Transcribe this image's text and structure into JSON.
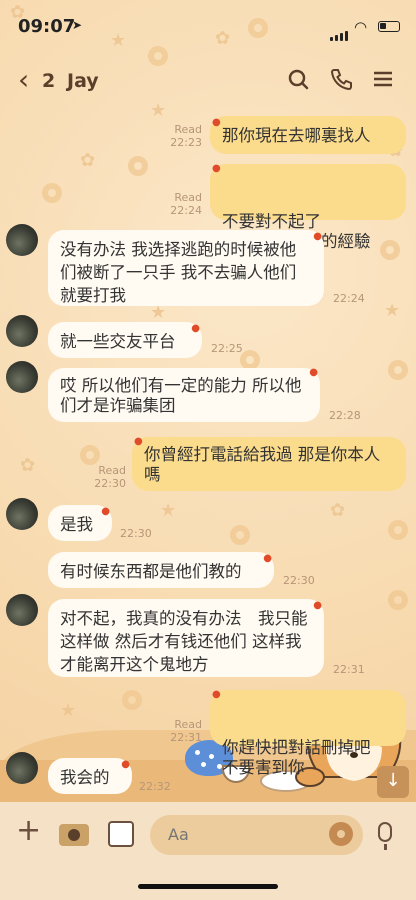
{
  "status_bar": {
    "time": "09:07",
    "location_icon": "location-arrow-icon",
    "signal_icon": "signal-icon",
    "wifi_icon": "wifi-icon",
    "battery_icon": "battery-icon"
  },
  "header": {
    "back_icon": "chevron-left-icon",
    "unread_count": "2",
    "title": "Jay",
    "icons": [
      "search-icon",
      "phone-icon",
      "menu-icon"
    ]
  },
  "messages": [
    {
      "side": "out",
      "text": "那你現在去哪裏找人",
      "read": "Read",
      "time": "22:23"
    },
    {
      "side": "out",
      "text": "不要對不起了\n這也是我學到的經驗",
      "read": "Read",
      "time": "22:24"
    },
    {
      "side": "in",
      "text": "没有办法 我选择逃跑的时候被他们被断了一只手 我不去骗人他们就要打我",
      "time": "22:24"
    },
    {
      "side": "in",
      "text": "就一些交友平台",
      "time": "22:25"
    },
    {
      "side": "in",
      "text": "哎 所以他们有一定的能力 所以他们才是诈骗集团",
      "time": "22:28"
    },
    {
      "side": "out",
      "text": "你曾經打電話給我過 那是你本人嗎",
      "read": "Read",
      "time": "22:30"
    },
    {
      "side": "in",
      "text": "是我",
      "time": "22:30"
    },
    {
      "side": "in",
      "text": "有时候东西都是他们教的",
      "time": "22:30"
    },
    {
      "side": "in",
      "text": "对不起，我真的没有办法　我只能这样做 然后才有钱还他们 这样我才能离开这个鬼地方",
      "time": "22:31"
    },
    {
      "side": "out",
      "text": "你趕快把對話刪掉吧\n不要害到你",
      "read": "Read",
      "time": "22:31"
    },
    {
      "side": "in",
      "text": "我会的",
      "time": "22:32"
    }
  ],
  "input_bar": {
    "placeholder": "Aa",
    "icons": [
      "plus-icon",
      "camera-icon",
      "gallery-icon",
      "emoji-icon",
      "microphone-icon"
    ]
  },
  "scroll_down_icon": "arrow-down-icon",
  "colors": {
    "incoming_bubble": "#fffaf2",
    "outgoing_bubble": "#fbdb8c",
    "header_text": "#5a3f2a",
    "background": "#f7d9ad"
  }
}
